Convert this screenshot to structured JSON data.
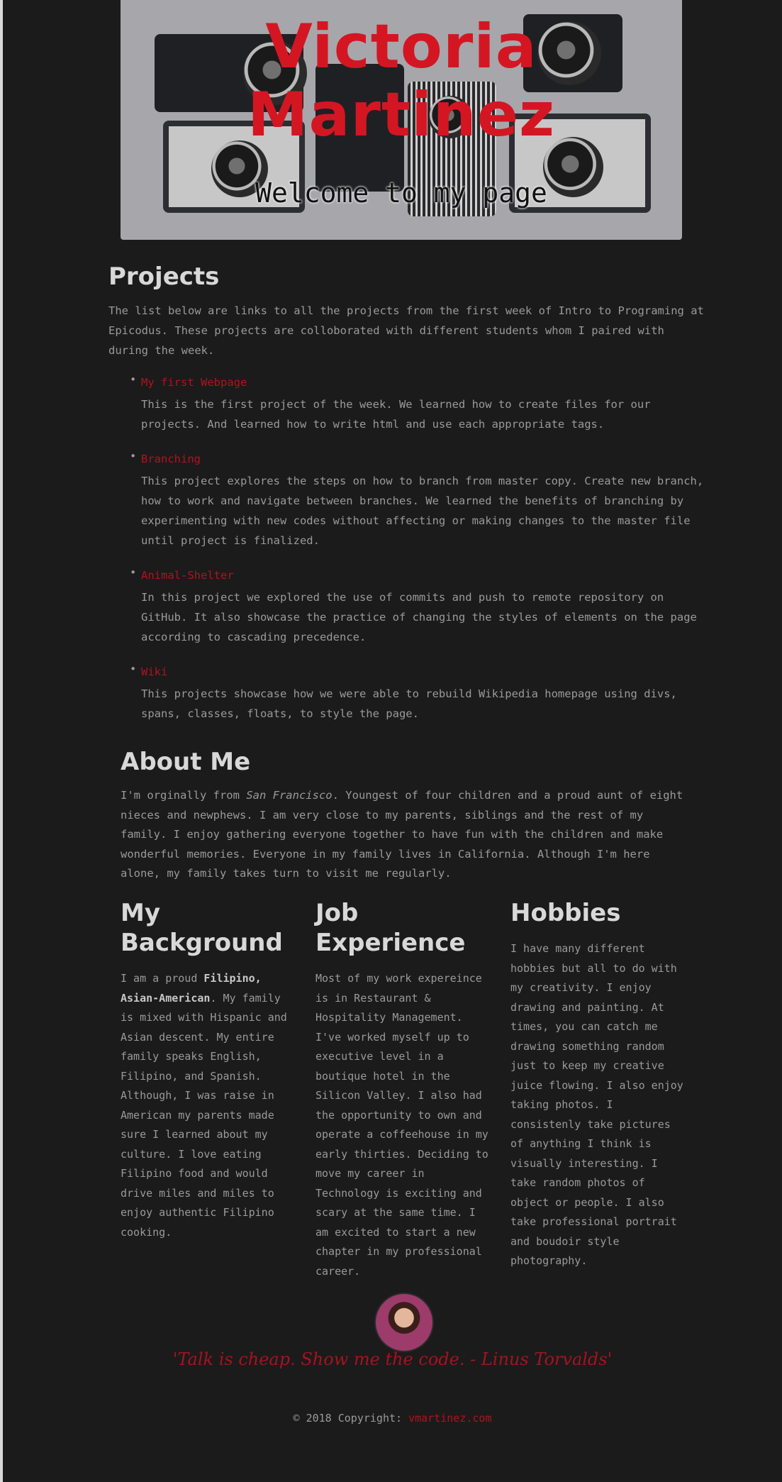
{
  "header": {
    "name_line1": "Victoria",
    "name_line2": "Martinez",
    "welcome": "Welcome to my page"
  },
  "projects": {
    "title": "Projects",
    "intro": "The list below are links to all the projects from the first week of Intro to Programing at Epicodus. These projects are colloborated with different students whom I paired with during the week.",
    "items": [
      {
        "link": "My first Webpage",
        "desc": "This is the first project of the week. We learned how to create files for our projects. And learned how to write html and use each appropriate tags."
      },
      {
        "link": "Branching",
        "desc": "This project explores the steps on how to branch from master copy. Create new branch, how to work and navigate between branches. We learned the benefits of branching by experimenting with new codes without affecting or making changes to the master file until project is finalized."
      },
      {
        "link": "Animal-Shelter",
        "desc": "In this project we explored the use of commits and push to remote repository on GitHub. It also showcase the practice of changing the styles of elements on the page according to cascading precedence."
      },
      {
        "link": "Wiki",
        "desc": "This projects showcase how we were able to rebuild Wikipedia homepage using divs, spans, classes, floats, to style the page."
      }
    ]
  },
  "about": {
    "title": "About Me",
    "text_before": "I'm orginally from ",
    "place": "San Francisco",
    "text_after": ". Youngest of four children and a proud aunt of eight nieces and newphews. I am very close to my parents, siblings and the rest of my family. I enjoy gathering everyone together to have fun with the children and make wonderful memories. Everyone in my family lives in California. Although I'm here alone, my family takes turn to visit me regularly."
  },
  "background": {
    "title": "My Background",
    "text_before": "I am a proud ",
    "strong": "Filipino, Asian-American",
    "text_after": ". My family is mixed with Hispanic and Asian descent. My entire family speaks English, Filipino, and Spanish. Although, I was raise in American my parents made sure I learned about my culture. I love eating Filipino food and would drive miles and miles to enjoy authentic Filipino cooking."
  },
  "job": {
    "title": "Job Experience",
    "text": "Most of my work expereince is in Restaurant & Hospitality Management. I've worked myself up to executive level in a boutique hotel in the Silicon Valley. I also had the opportunity to own and operate a coffeehouse in my early thirties. Deciding to move my career in Technology is exciting and scary at the same time. I am excited to start a new chapter in my professional career."
  },
  "hobbies": {
    "title": "Hobbies",
    "text": "I have many different hobbies but all to do with my creativity. I enjoy drawing and painting. At times, you can catch me drawing something random just to keep my creative juice flowing. I also enjoy taking photos. I consistenly take pictures of anything I think is visually interesting. I take random photos of object or people. I also take professional portrait and boudoir style photography."
  },
  "footer": {
    "quote": "'Talk is cheap. Show me the code. - Linus Torvalds'",
    "copyright": "© 2018 Copyright: ",
    "site": "vmartinez.com"
  },
  "colors": {
    "accent": "#b3121c",
    "background": "#1b1b1c",
    "text": "#9a9a9a"
  }
}
